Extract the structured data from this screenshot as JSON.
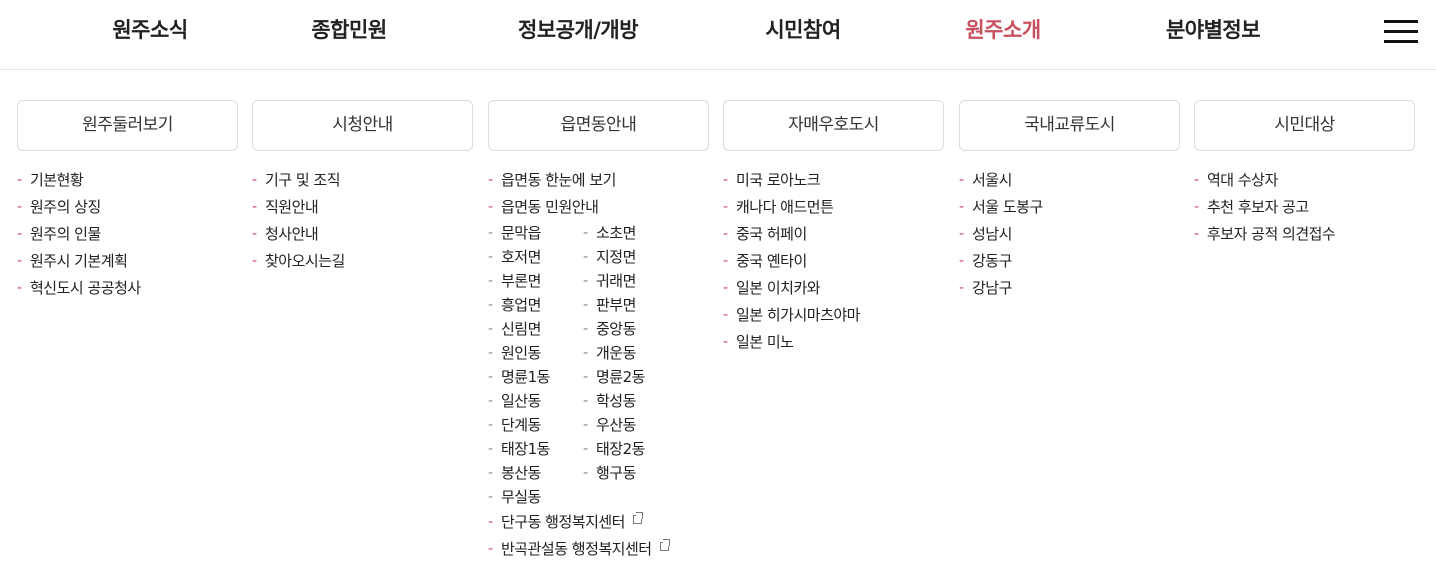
{
  "gnb": {
    "items": [
      {
        "label": "원주소식"
      },
      {
        "label": "종합민원"
      },
      {
        "label": "정보공개/개방"
      },
      {
        "label": "시민참여"
      },
      {
        "label": "원주소개"
      },
      {
        "label": "분야별정보"
      }
    ],
    "active_index": 4,
    "menu_icon": "hamburger-menu-icon"
  },
  "colors": {
    "accent": "#c9505e",
    "dash": "#d0445a",
    "text": "#222222",
    "border": "#dcdcdc"
  },
  "columns": [
    {
      "title": "원주둘러보기",
      "items": [
        "기본현황",
        "원주의 상징",
        "원주의 인물",
        "원주시 기본계획",
        "혁신도시 공공청사"
      ]
    },
    {
      "title": "시청안내",
      "items": [
        "기구 및 조직",
        "직원안내",
        "청사안내",
        "찾아오시는길"
      ]
    },
    {
      "title": "읍면동안내",
      "items": [
        "읍면동 한눈에 보기",
        "읍면동 민원안내"
      ],
      "sub_left": [
        "문막읍",
        "호저면",
        "부론면",
        "흥업면",
        "신림면",
        "원인동",
        "명륜1동",
        "일산동",
        "단계동",
        "태장1동",
        "봉산동",
        "무실동"
      ],
      "sub_right": [
        "소초면",
        "지정면",
        "귀래면",
        "판부면",
        "중앙동",
        "개운동",
        "명륜2동",
        "학성동",
        "우산동",
        "태장2동",
        "행구동"
      ],
      "external": [
        "단구동 행정복지센터",
        "반곡관설동 행정복지센터"
      ],
      "external_icon": "external-link-icon"
    },
    {
      "title": "자매우호도시",
      "items": [
        "미국 로아노크",
        "캐나다 애드먼튼",
        "중국 허페이",
        "중국 옌타이",
        "일본 이치카와",
        "일본 히가시마츠야마",
        "일본 미노"
      ]
    },
    {
      "title": "국내교류도시",
      "items": [
        "서울시",
        "서울 도봉구",
        "성남시",
        "강동구",
        "강남구"
      ]
    },
    {
      "title": "시민대상",
      "items": [
        "역대 수상자",
        "추천 후보자 공고",
        "후보자 공적 의견접수"
      ]
    }
  ]
}
